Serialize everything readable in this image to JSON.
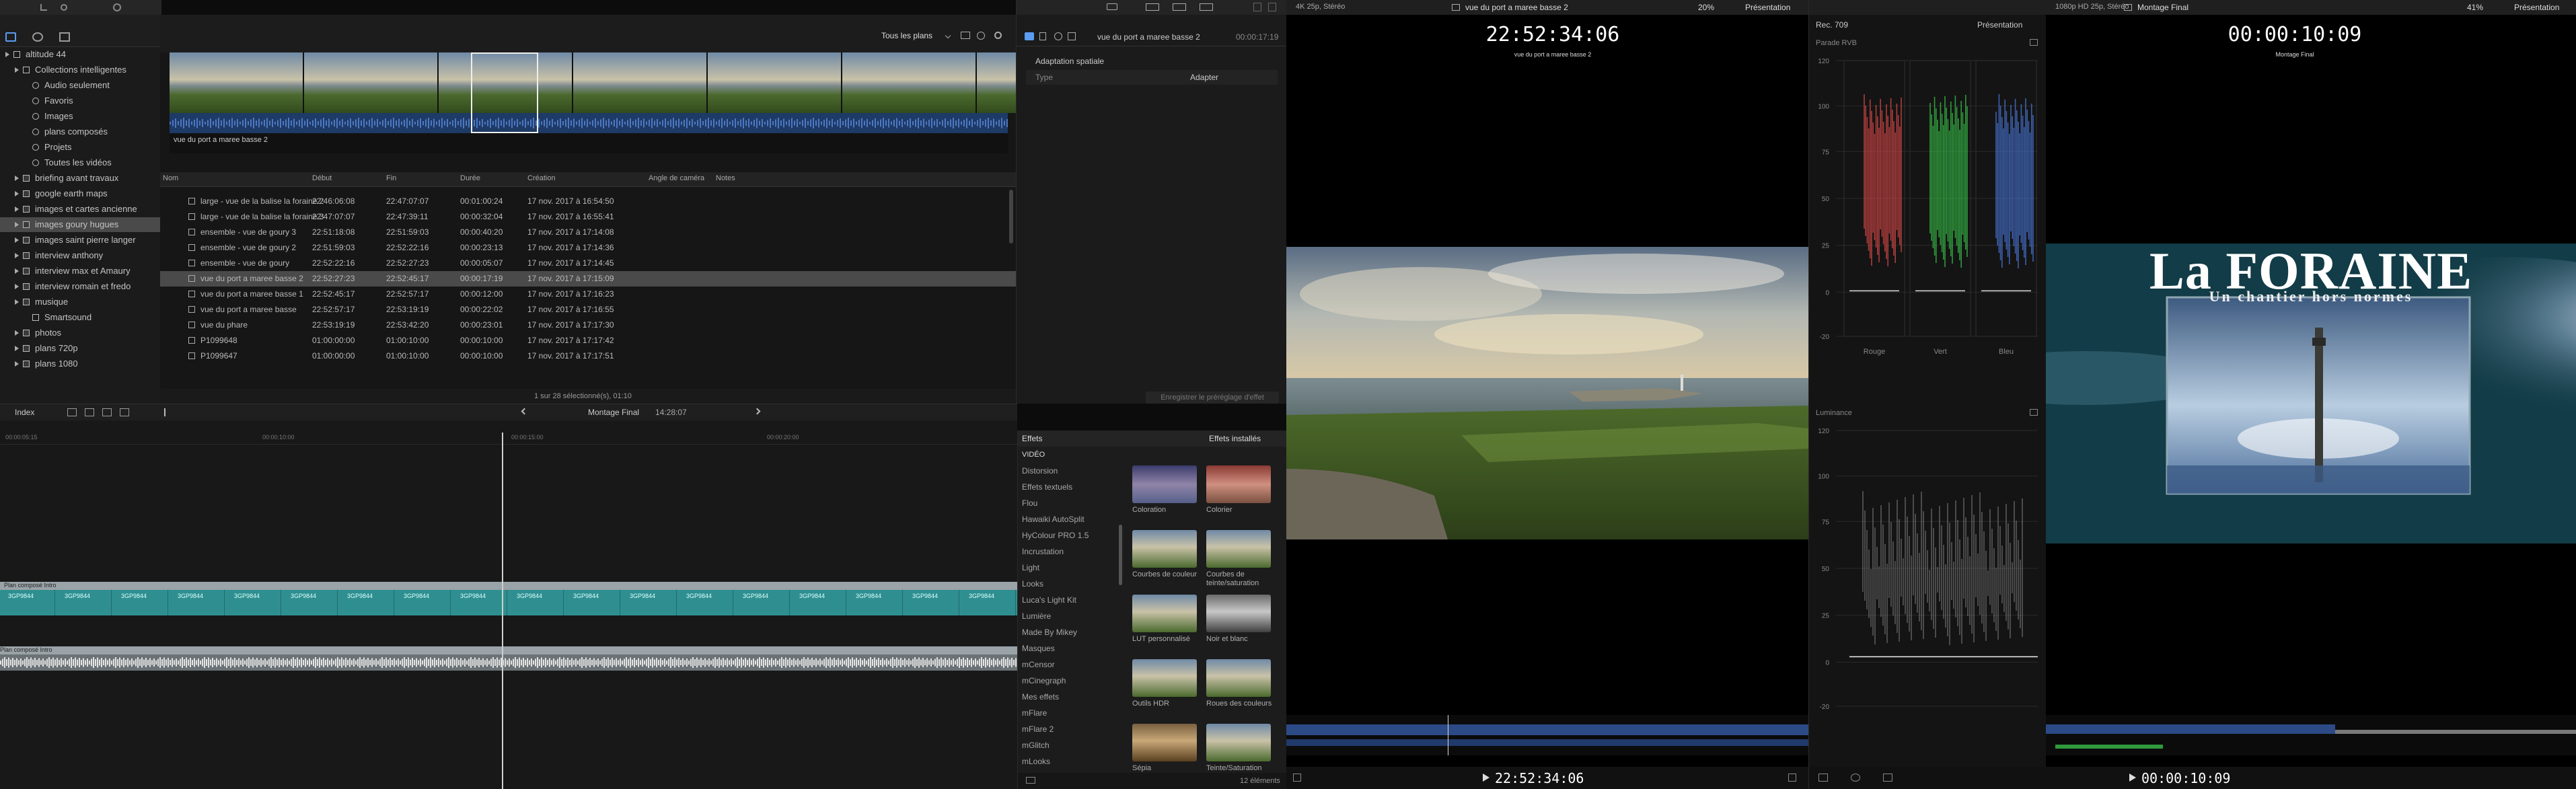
{
  "sidebar": {
    "items": [
      {
        "label": "altitude 44",
        "level": 0,
        "icon": "library"
      },
      {
        "label": "Collections intelligentes",
        "level": 1,
        "icon": "folder"
      },
      {
        "label": "Audio seulement",
        "level": 2,
        "icon": "gear"
      },
      {
        "label": "Favoris",
        "level": 2,
        "icon": "gear"
      },
      {
        "label": "Images",
        "level": 2,
        "icon": "gear"
      },
      {
        "label": "plans composés",
        "level": 2,
        "icon": "gear"
      },
      {
        "label": "Projets",
        "level": 2,
        "icon": "gear"
      },
      {
        "label": "Toutes les vidéos",
        "level": 2,
        "icon": "gear"
      },
      {
        "label": "briefing avant travaux",
        "level": 1,
        "icon": "event"
      },
      {
        "label": "google earth maps",
        "level": 1,
        "icon": "event"
      },
      {
        "label": "images et cartes ancienne",
        "level": 1,
        "icon": "event"
      },
      {
        "label": "images goury hugues",
        "level": 1,
        "icon": "event",
        "selected": true
      },
      {
        "label": "images saint pierre langer",
        "level": 1,
        "icon": "event"
      },
      {
        "label": "interview anthony",
        "level": 1,
        "icon": "event"
      },
      {
        "label": "interview max et Amaury",
        "level": 1,
        "icon": "event"
      },
      {
        "label": "interview romain et fredo",
        "level": 1,
        "icon": "event"
      },
      {
        "label": "musique",
        "level": 1,
        "icon": "event"
      },
      {
        "label": "Smartsound",
        "level": 2,
        "icon": "music"
      },
      {
        "label": "photos",
        "level": 1,
        "icon": "event"
      },
      {
        "label": "plans 720p",
        "level": 1,
        "icon": "event"
      },
      {
        "label": "plans 1080",
        "level": 1,
        "icon": "event"
      }
    ]
  },
  "browser": {
    "filter": "Tous les plans",
    "filmstrip_label": "vue du port a maree basse 2",
    "columns": [
      "Nom",
      "Début",
      "Fin",
      "Durée",
      "Création",
      "Angle de caméra",
      "Notes"
    ],
    "rows": [
      {
        "name": "large - vue de la balise la foraine 2",
        "start": "22:46:06:08",
        "end": "22:47:07:07",
        "dur": "00:01:00:24",
        "created": "17 nov. 2017 à 16:54:50"
      },
      {
        "name": "large - vue de la balise la foraine 3",
        "start": "22:47:07:07",
        "end": "22:47:39:11",
        "dur": "00:00:32:04",
        "created": "17 nov. 2017 à 16:55:41"
      },
      {
        "name": "ensemble - vue de goury 3",
        "start": "22:51:18:08",
        "end": "22:51:59:03",
        "dur": "00:00:40:20",
        "created": "17 nov. 2017 à 17:14:08"
      },
      {
        "name": "ensemble - vue de goury 2",
        "start": "22:51:59:03",
        "end": "22:52:22:16",
        "dur": "00:00:23:13",
        "created": "17 nov. 2017 à 17:14:36"
      },
      {
        "name": "ensemble - vue de goury",
        "start": "22:52:22:16",
        "end": "22:52:27:23",
        "dur": "00:00:05:07",
        "created": "17 nov. 2017 à 17:14:45"
      },
      {
        "name": "vue du port a maree basse 2",
        "start": "22:52:27:23",
        "end": "22:52:45:17",
        "dur": "00:00:17:19",
        "created": "17 nov. 2017 à 17:15:09",
        "selected": true
      },
      {
        "name": "vue du port a maree basse 1",
        "start": "22:52:45:17",
        "end": "22:52:57:17",
        "dur": "00:00:12:00",
        "created": "17 nov. 2017 à 17:16:23"
      },
      {
        "name": "vue du port a maree basse",
        "start": "22:52:57:17",
        "end": "22:53:19:19",
        "dur": "00:00:22:02",
        "created": "17 nov. 2017 à 17:16:55"
      },
      {
        "name": "vue du phare",
        "start": "22:53:19:19",
        "end": "22:53:42:20",
        "dur": "00:00:23:01",
        "created": "17 nov. 2017 à 17:17:30"
      },
      {
        "name": "P1099648",
        "start": "01:00:00:00",
        "end": "01:00:10:00",
        "dur": "00:00:10:00",
        "created": "17 nov. 2017 à 17:17:42"
      },
      {
        "name": "P1099647",
        "start": "01:00:00:00",
        "end": "01:00:10:00",
        "dur": "00:00:10:00",
        "created": "17 nov. 2017 à 17:17:51"
      }
    ],
    "status": "1 sur 28 sélectionné(s), 01:10"
  },
  "inspector": {
    "clip_name": "vue du port a maree basse 2",
    "duration": "00:00:17:19",
    "section": "Adaptation spatiale",
    "type_label": "Type",
    "type_value": "Adapter",
    "save_btn": "Enregistrer le préréglage d'effet"
  },
  "viewer1": {
    "format": "4K 25p, Stéréo",
    "clip_name": "vue du port a maree basse 2",
    "zoom": "20%",
    "presentation": "Présentation",
    "timecode": "22:52:34:06",
    "tc_label": "vue du port a maree basse 2",
    "bottom_tc": "22:52:34:06"
  },
  "scopes": {
    "mode": "Rec. 709",
    "presentation": "Présentation",
    "rgb_title": "Parade RVB",
    "rgb_ticks": [
      "120",
      "100",
      "75",
      "50",
      "25",
      "0",
      "-20"
    ],
    "channels": [
      "Rouge",
      "Vert",
      "Bleu"
    ],
    "luma_title": "Luminance",
    "luma_ticks": [
      "120",
      "100",
      "75",
      "50",
      "25",
      "0",
      "-20"
    ]
  },
  "viewer2": {
    "format": "1080p HD 25p, Stéréo",
    "project": "Montage Final",
    "zoom": "41%",
    "presentation": "Présentation",
    "timecode": "00:00:10:09",
    "tc_label": "Montage Final",
    "title_main": "La FORAINE",
    "title_sub": "Un chantier hors normes",
    "bottom_tc": "00:00:10:09"
  },
  "timeline": {
    "index_label": "Index",
    "project": "Montage Final",
    "duration": "14:28:07",
    "ruler": [
      "00:00:05:15",
      "00:00:10:00",
      "00:00:15:00",
      "00:00:20:00"
    ],
    "clip1": "Plan composé Intro",
    "clip2": "Plan composé Intro",
    "segment_label": "3GP9844"
  },
  "effects": {
    "title": "Effets",
    "installed": "Effets installés",
    "categories": [
      "VIDÉO",
      "Distorsion",
      "Effets textuels",
      "Flou",
      "Hawaiki AutoSplit",
      "HyColour PRO 1.5",
      "Incrustation",
      "Light",
      "Looks",
      "Luca's Light Kit",
      "Lumière",
      "Made By Mikey",
      "Masques",
      "mCensor",
      "mCinegraph",
      "Mes effets",
      "mFlare",
      "mFlare 2",
      "mGlitch",
      "mLooks"
    ],
    "items": [
      "Coloration",
      "Colorier",
      "Courbes de couleur",
      "Courbes de teinte/saturation",
      "LUT personnalisé",
      "Noir et blanc",
      "Outils HDR",
      "Roues des couleurs",
      "Sépia",
      "Teinte/Saturation"
    ],
    "count": "12 éléments"
  },
  "colors": {
    "accent": "#5b9cf0",
    "clip_teal": "#2f8f90",
    "audio": "#3b5fa0",
    "selection": "#4a4a4a"
  }
}
